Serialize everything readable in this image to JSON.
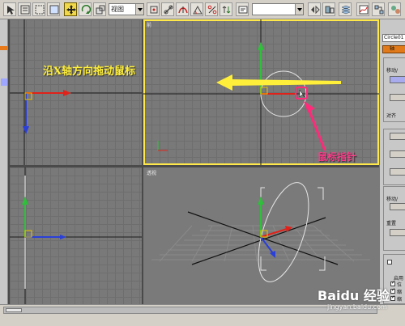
{
  "toolbar": {
    "view_combo": "视图",
    "named_selection": "",
    "colors": {
      "active_button": "#f0d84a"
    }
  },
  "viewports": {
    "top_left": {
      "label": ""
    },
    "top_right": {
      "label": "前"
    },
    "bottom_left": {
      "label": ""
    },
    "bottom_right": {
      "label": "透视"
    },
    "active_border_color": "#ffe94a"
  },
  "command_panel": {
    "object_name": "Circle01",
    "tab_label": "轴",
    "move_label": "移动/",
    "align_label": "对齐",
    "move2_label": "移动/",
    "reset_label": "重置",
    "enable_label": "启用",
    "check_1": "位",
    "check_2": "缩",
    "check_3": "缩"
  },
  "annotations": {
    "drag_hint": "沿X轴方向拖动鼠标",
    "cursor_hint": "鼠标指针",
    "drag_color": "#ffef3a",
    "cursor_color": "#ff3a8a"
  },
  "axes": {
    "x_label": "x",
    "y_label": "y",
    "z_label": "z",
    "x_color": "#e0221a",
    "y_color": "#2fbf3a",
    "z_color": "#2a3fd8"
  },
  "watermark": {
    "logo": "Baidu 经验",
    "url": "jingyan.baidu.com"
  }
}
